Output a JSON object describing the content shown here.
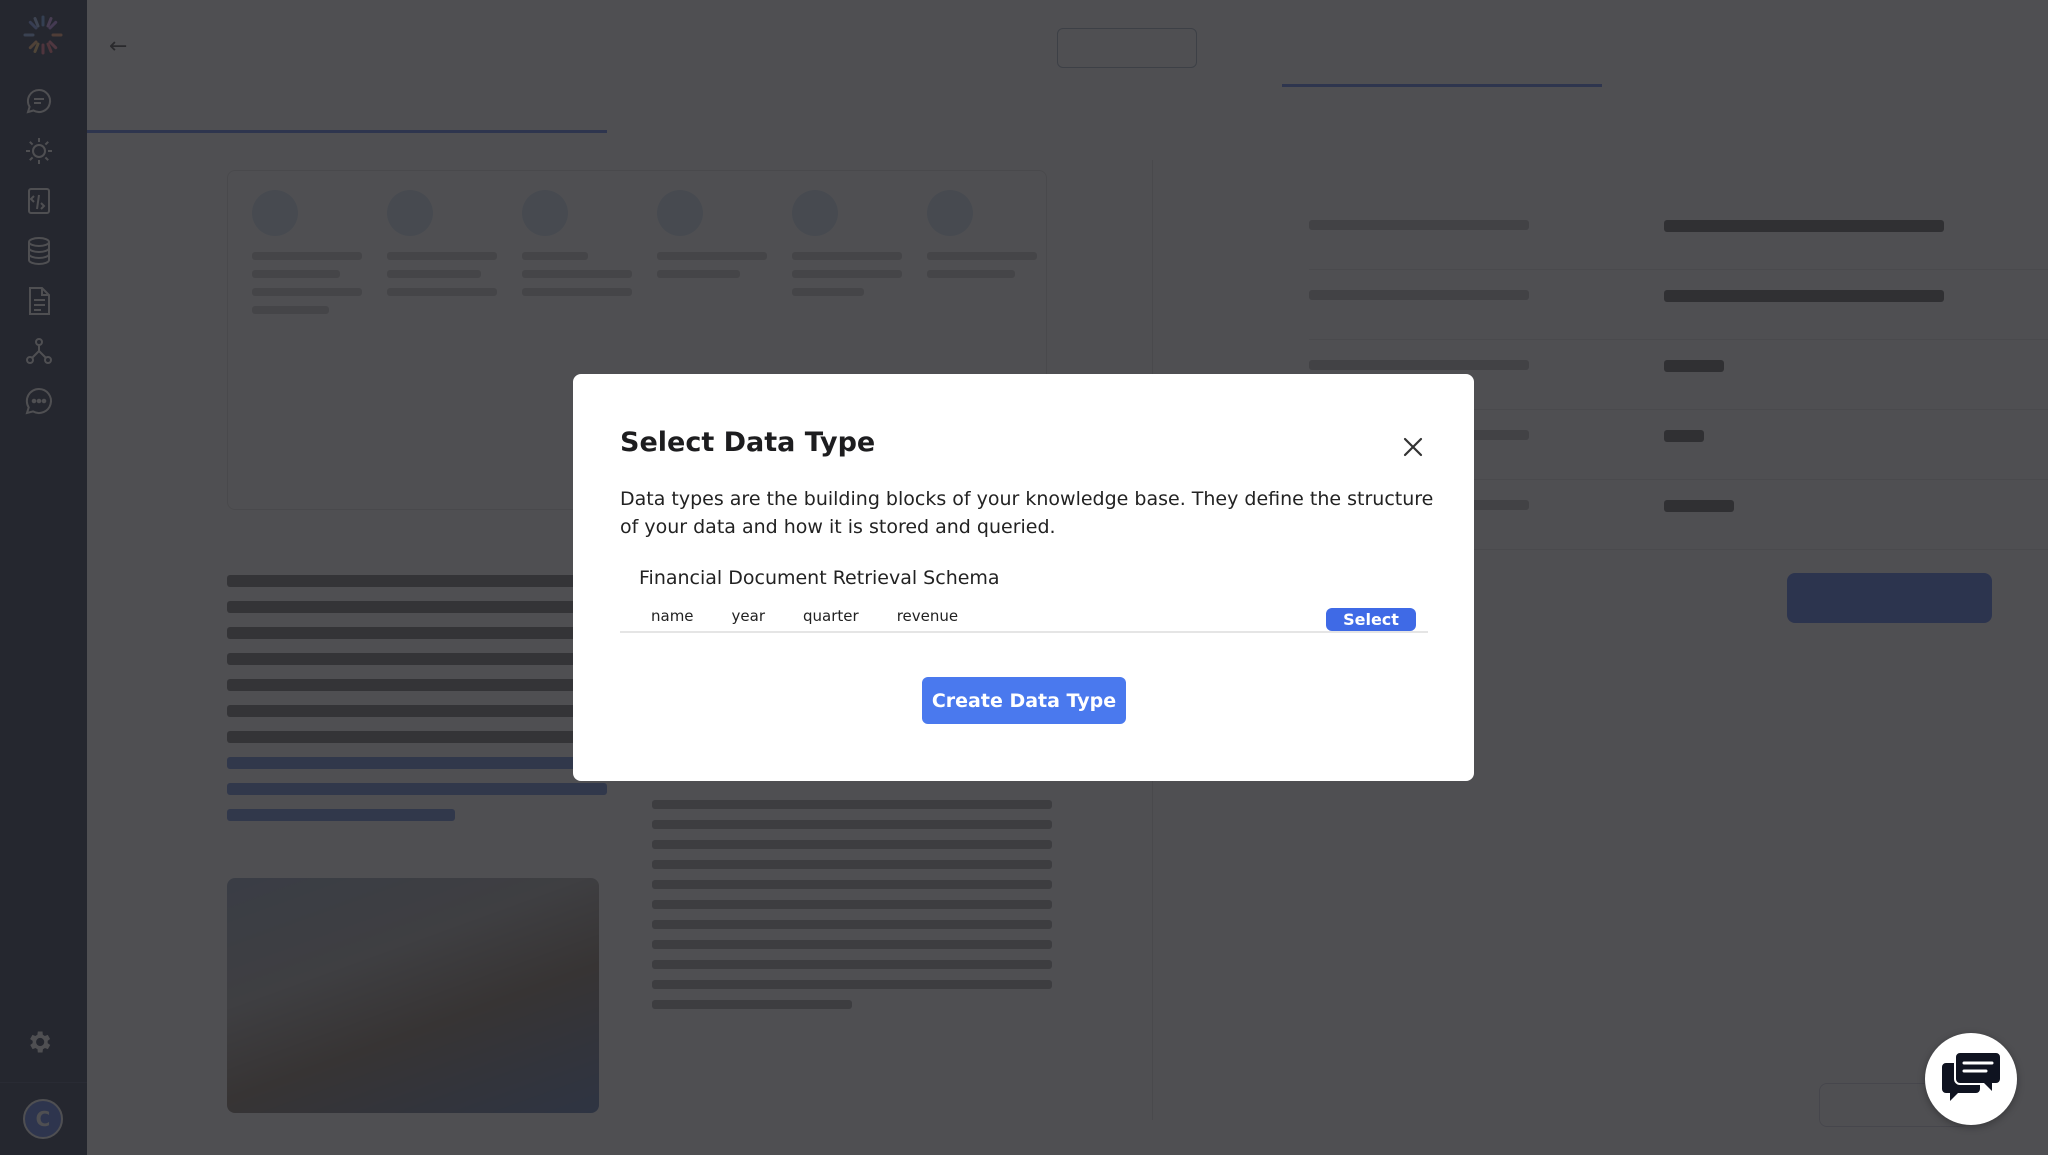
{
  "sidebar": {
    "avatar_letter": "C",
    "icons": [
      "chat-icon",
      "sun-icon",
      "document-code-icon",
      "database-icon",
      "file-text-icon",
      "graph-icon",
      "message-dots-icon",
      "gear-icon"
    ]
  },
  "modal": {
    "title": "Select Data Type",
    "description": "Data types are the building blocks of your knowledge base. They define the structure of your data and how it is stored and queried.",
    "schemas": [
      {
        "name": "Financial Document Retrieval Schema",
        "fields": [
          "name",
          "year",
          "quarter",
          "revenue"
        ],
        "select_label": "Select"
      }
    ],
    "create_label": "Create Data Type"
  },
  "colors": {
    "sidebar": "#18223d",
    "accent": "#3f6ae6",
    "overlay": "rgba(40,40,44,0.82)"
  }
}
